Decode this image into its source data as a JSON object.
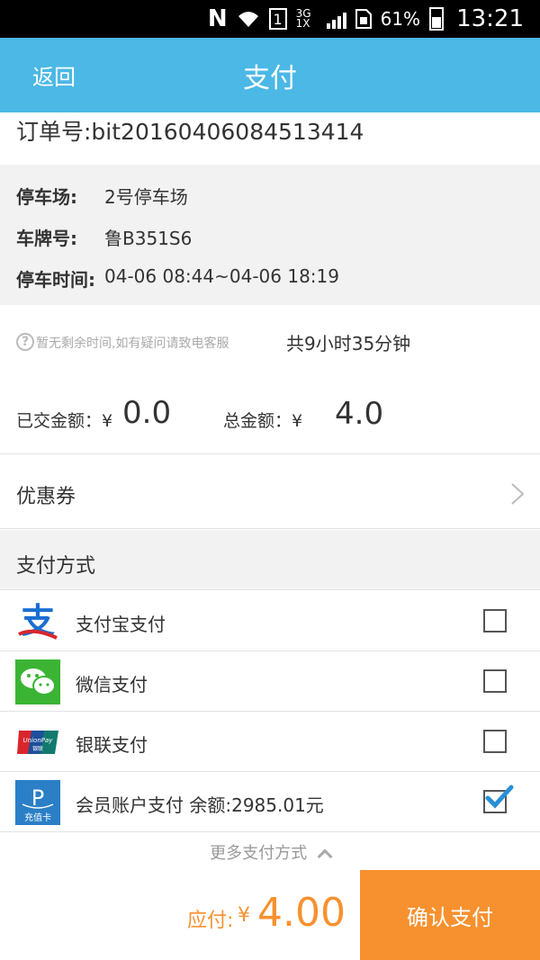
{
  "status_bar": {
    "network": "3G 1X",
    "battery": "61%",
    "sim": "1",
    "time": "13:21"
  },
  "header": {
    "back_label": "返回",
    "title": "支付"
  },
  "order": {
    "number_text": "订单号:bit20160406084513414"
  },
  "info": {
    "lot_label": "停车场:",
    "lot_value": "2号停车场",
    "plate_label": "车牌号:",
    "plate_value": "鲁B351S6",
    "time_label": "停车时间:",
    "time_value": "04-06 08:44~04-06 18:19"
  },
  "amount": {
    "hint_icon": "?",
    "hint": "暂无剩余时间,如有疑问请致电客服",
    "duration": "共9小时35分钟",
    "paid_label": "已交金额：¥",
    "paid_value": "0.0",
    "total_label": "总金额：¥",
    "total_value": "4.0"
  },
  "coupon": {
    "label": "优惠券"
  },
  "payment": {
    "header": "支付方式",
    "methods": [
      {
        "label": "支付宝支付",
        "icon": "alipay-icon",
        "checked": false
      },
      {
        "label": "微信支付",
        "icon": "wechat-icon",
        "checked": false
      },
      {
        "label": "银联支付",
        "icon": "unionpay-icon",
        "checked": false
      },
      {
        "label": "会员账户支付   余额:2985.01元",
        "icon": "member-card-icon",
        "checked": true
      }
    ],
    "more_label": "更多支付方式",
    "unionpay_logo_text": "UnionPay",
    "unionpay_logo_sub": "银联",
    "member_logo_text": "P",
    "member_logo_sub": "充值卡",
    "alipay_glyph": "支"
  },
  "footer": {
    "due_label": "应付:",
    "due_currency": "¥",
    "due_value": "4.00",
    "confirm_label": "确认支付"
  },
  "colors": {
    "header_bg": "#4bb8e6",
    "accent_orange": "#f7912f",
    "wechat_green": "#3bb434",
    "alipay_blue": "#1a6ed2",
    "unionpay_red": "#d8262c",
    "member_blue": "#2a7fc7",
    "check_blue": "#2a8fd6"
  }
}
